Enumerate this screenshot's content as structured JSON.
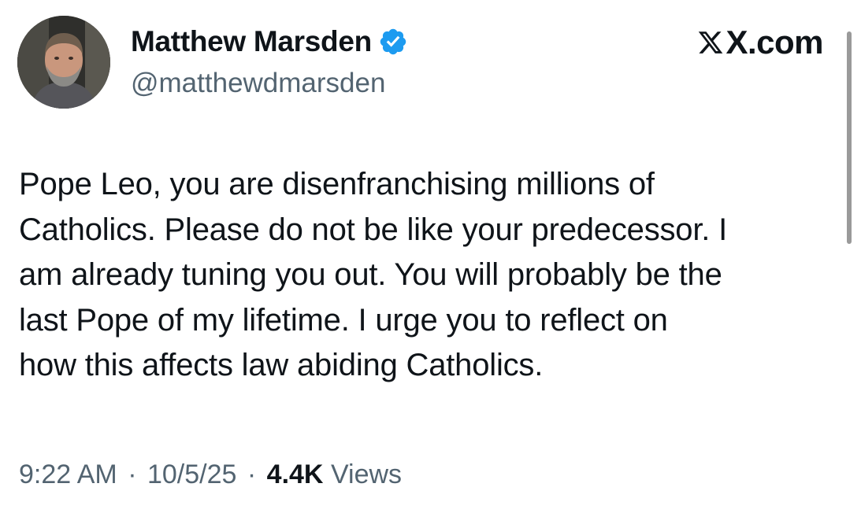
{
  "author": {
    "display_name": "Matthew Marsden",
    "handle": "@matthewdmarsden",
    "verified": true,
    "avatar_icon": "profile-photo-icon"
  },
  "site": {
    "label": "X.com",
    "icon": "x-logo-icon"
  },
  "tweet": {
    "lines": [
      "Pope Leo, you are disenfranchising millions of",
      "Catholics. Please do not be like your predecessor. I",
      "am already tuning you out. You will probably be the",
      "last Pope of my lifetime. I urge you to reflect on",
      "how this affects law abiding Catholics."
    ]
  },
  "meta": {
    "time": "9:22 AM",
    "separator": "·",
    "date": "10/5/25",
    "views_count": "4.4K",
    "views_label": "Views"
  },
  "colors": {
    "text": "#0f1419",
    "secondary_text": "#536471",
    "verified_blue": "#1d9bf0",
    "background": "#ffffff"
  }
}
